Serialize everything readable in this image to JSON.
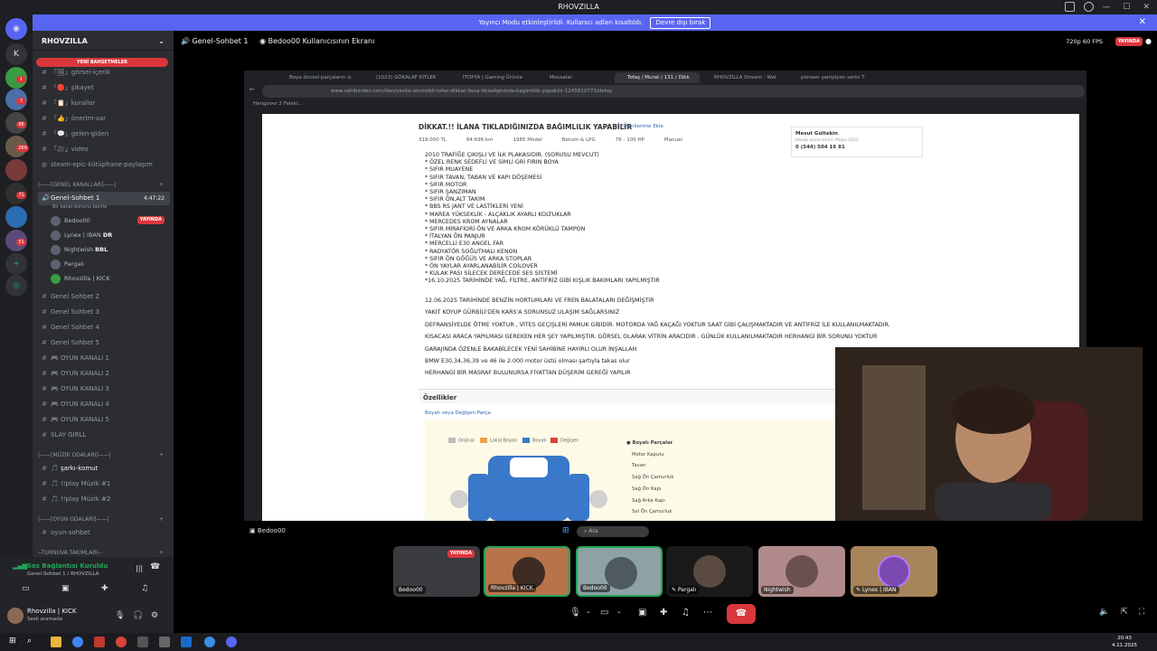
{
  "window": {
    "title": "RHOVZILLA"
  },
  "banner": {
    "text": "Yayıncı Modu etkinleştirildi. Kullanıcı adları kısaltıldı.",
    "button": "Devre dışı bırak"
  },
  "servers": {
    "badges": [
      "1",
      "7",
      "86",
      "269",
      "71",
      "51"
    ],
    "top_letter": "K"
  },
  "sidebar": {
    "server_name": "RHOVZILLA",
    "new_messages": "YENİ BAHSETMELER",
    "text_channels": [
      {
        "label": "「🖼」görsel-içerik"
      },
      {
        "label": "「🔴」şikayet"
      },
      {
        "label": "「📋」kurallar"
      },
      {
        "label": "「👍」önerim-var"
      },
      {
        "label": "「💬」gelen-giden"
      },
      {
        "label": "「🎥」video"
      },
      {
        "label": "steam-epic-kütüphane-paylaşım"
      }
    ],
    "cat_general": "|——[GENEL KANALLAR]——|",
    "active_voice": {
      "name": "Genel-Sohbet 1",
      "timer": "4:47:22",
      "status": "Bir kanal durumu belirle"
    },
    "voice_users": [
      {
        "name": "Bedoo00",
        "badge": "YAYINDA"
      },
      {
        "name": "Lynex | IBAN",
        "extra": "DR"
      },
      {
        "name": "Nightwish",
        "extra": "BBL"
      },
      {
        "name": "Pargalı"
      },
      {
        "name": "Rhovzilla | KICK"
      }
    ],
    "voice_channels": [
      "Genel Sohbet 2",
      "Genel Sohbet 3",
      "Genel Sohbet 4",
      "Genel Sohbet 5",
      "🎮 OYUN KANALI 1",
      "🎮 OYUN KANALI 2",
      "🎮 OYUN KANALI 3",
      "🎮 OYUN KANALI 4",
      "🎮 OYUN KANALI 5",
      "SLAY GIRLL"
    ],
    "cat_music": "|——[MÜZİK ODALARI]——|",
    "music_channels": [
      "🎵 şarkı-komut",
      "🎵 !!play Müzik #1",
      "🎵 !!play Müzik #2"
    ],
    "cat_game": "|——[OYUN ODALARI]——|",
    "game_channels": [
      "oyun-sohbet"
    ],
    "cat_tournament": "--TURNUVA TAKIMLARI--"
  },
  "voice_status": {
    "title": "Ses Bağlantısı Kuruldu",
    "channel": "Genel-Sohbet 1 / RHOVZILLA"
  },
  "user": {
    "name": "Rhovzilla | KICK",
    "status": "Sesli aramada"
  },
  "call_header": {
    "channel": "Genel-Sohbet 1",
    "screen": "Bedoo00 Kullanıcısının Ekranı",
    "quality": "720p 60 FPS",
    "live": "YAYINDA"
  },
  "browser": {
    "tabs": [
      "Boya öncesi parçaların sı",
      "(1023) GÖKALAF KİTLEK",
      "İTOPYA | Gaming Ürünle",
      "Mouselar",
      "Tofaş / Murat / 131 / Dikk",
      "RHOVZILLA Stream - Wat",
      "pioneer şampiyon serisi T"
    ],
    "url": "www.sahibinden.com/ilan/vasita-otomobil-tofas-dikkat-ilana-tikladiginizda-bagimlilik-yapabilir-1245810773/detay",
    "bookmark": "Hangover 2 Feleki..."
  },
  "listing": {
    "title": "DİKKAT.!! İLANA TIKLADIĞINIZDA BAĞIMLILIK YAPABİLİR",
    "favorite": "Favorilerime Ekle",
    "specs": [
      "319.000 TL",
      "84.696 km",
      "1985 Model",
      "Benzin & LPG",
      "76 - 100 HP",
      "Manuel"
    ],
    "seller_name": "Mesut Gültekin",
    "seller_since": "Hesap açma tarihi: Mayıs 2023",
    "seller_phone": "0 (544) 504 16 81",
    "desc_lines": "2010 TRAFİĞE ÇIKIŞLI VE İLK PLAKASIDIR. (SORUSU MEVCUT)\n* ÖZEL RENK SEDEFLİ VE SİMLİ GRİ FIRIN BOYA\n* SIFIR MUAYENE\n* SIFIR TAVAN, TABAN VE KAPI DÖŞEMESİ\n* SIFIR MOTOR\n* SIFIR ŞANZIMAN\n* SIFIR ÖN,ALT TAKIM\n* BBS RS JANT VE LASTİKLERİ YENİ\n* MAREA YÜKSEKLİK - ALÇAKLIK AYARLI KOLTUKLAR\n* MERCEDES KROM AYNALAR\n* SIFIR MİRAFİORİ ÖN VE ARKA KROM KÖRÜKLÜ TAMPON\n* İTALYAN ÖN PANJUR\n* MERCELLİ E30 ANGEL FAR\n* RADYATÖR SOĞUTMALI KENON\n* SIFIR ÖN GÖĞÜS VE ARKA STOPLAR\n* ÖN YAYLAR AYARLANABİLİR COİLOVER\n* KULAK PASI SİLECEK DERECEDE SES SİSTEMİ\n*16.10.2025 TARİHİNDE YAĞ, FİLTRE, ANTİFRİZ GİBİ KIŞLIK BAKIMLARI YAPILMIŞTIR",
    "desc_paras": "12.06.2025 TARİHİNDE BENZİN HORTUMLARI VE FREN BALATALARI DEĞİŞMİŞTİR\nYAKIT KOYUP GÜRBİLİ'DEN KARS'A SORUNSUZ ULAŞIM SAĞLARSINIZ\nDEFRANSİYELDE ÖTME YOKTUR , VİTES GEÇİŞLERİ PAMUK GİBİDİR. MOTORDA YAĞ KAÇAĞI YOKTUR SAAT GİBİ ÇALIŞMAKTADIR VE ANTİFRİZ İLE KULLANILMAKTADIR.\nKISACASI ARACA YAPILMASI GEREKEN HER ŞEY YAPILMIŞTIR. GÖRSEL OLARAK VİTRİN ARACIDIR . GÜNLÜK KULLANILMAKTADIR HERHANGİ BİR SORUNU YOKTUR\nGARAJINDA ÖZENLE BAKABİLECEK YENİ SAHİBİNE HAYIRLI OLUR İNŞALLAH\nBMW E30,34,36,39 ve 46 ile 2.000 motor üstü olması şartıyla takas olur\nHERHANGİ BİR MASRAF BULUNURSA FİYATTAN DÜŞERİM GEREĞİ YAPILIR",
    "features_title": "Özellikler",
    "painted_link": "Boyalı veya Değişen Parça.",
    "legend": [
      "Orijinal",
      "Lokal Boyalı",
      "Boyalı",
      "Değişen"
    ],
    "legend_colors": [
      "#bdbdbd",
      "#f0a04b",
      "#3a78c9",
      "#d9443a"
    ],
    "parts": [
      "Boyalı Parçalar",
      "Motor Kaputu",
      "Tavan",
      "Sağ Ön Çamurluk",
      "Sağ Ön Kapı",
      "Sağ Arka Kapı",
      "Sol Ön Çamurluk"
    ]
  },
  "stream": {
    "sharer": "Bedoo00",
    "search": "Ara"
  },
  "tiles": [
    {
      "name": "Bedoo00",
      "badge": "YAYINDA"
    },
    {
      "name": "Rhovzilla | KICK"
    },
    {
      "name": "Bedoo00"
    },
    {
      "name": "Pargalı"
    },
    {
      "name": "Nightwish"
    },
    {
      "name": "Lynex | IBAN"
    }
  ],
  "taskbar": {
    "time": "20:43",
    "date": "4.11.2025"
  }
}
